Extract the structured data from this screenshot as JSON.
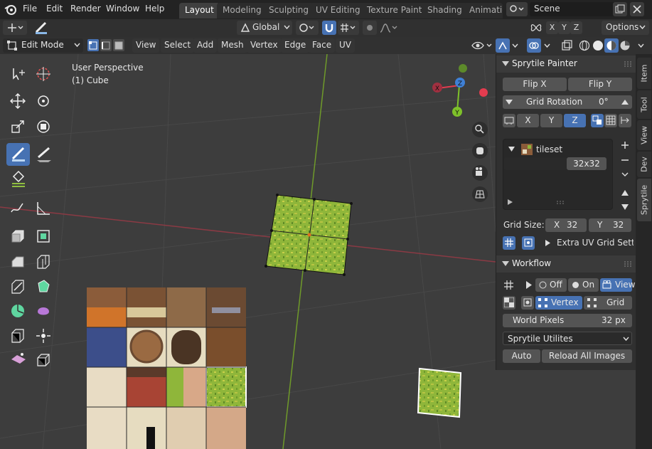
{
  "menu": {
    "logo_icon": "blender-logo-icon",
    "items": [
      "File",
      "Edit",
      "Render",
      "Window",
      "Help"
    ]
  },
  "workspaces": {
    "tabs": [
      "Layout",
      "Modeling",
      "Sculpting",
      "UV Editing",
      "Texture Paint",
      "Shading",
      "Animatic"
    ],
    "active": "Layout"
  },
  "scene": {
    "name": "Scene"
  },
  "toolheader": {
    "orientation": "Global",
    "axes": [
      "X",
      "Y",
      "Z"
    ],
    "options_label": "Options"
  },
  "viewport_header": {
    "mode": "Edit Mode",
    "menus": [
      "View",
      "Select",
      "Add",
      "Mesh",
      "Vertex",
      "Edge",
      "Face",
      "UV"
    ]
  },
  "viewport": {
    "perspective": "User Perspective",
    "object": "(1) Cube",
    "gizmo_axes": [
      "X",
      "Y",
      "Z"
    ],
    "colors": {
      "background": "#3d3d3d",
      "grid_line": "#4a4a4a",
      "x_axis": "#8b3a44",
      "y_axis": "#6f9a2a",
      "x_gizmo": "#e33c4f",
      "y_gizmo": "#7ec12a",
      "z_gizmo": "#3f80d6"
    }
  },
  "npanel": {
    "painter": {
      "title": "Sprytile Painter",
      "flip_x": "Flip X",
      "flip_y": "Flip Y",
      "grid_rotation_label": "Grid Rotation",
      "grid_rotation_value": "0°",
      "axes": [
        "X",
        "Y",
        "Z"
      ],
      "active_axis": "Z",
      "tileset_name": "tileset",
      "tileset_size": "32x32",
      "grid_size_label": "Grid Size:",
      "grid_x_label": "X",
      "grid_x_value": "32",
      "grid_y_label": "Y",
      "grid_y_value": "32",
      "extra_uv": "Extra UV Grid Setti..."
    },
    "workflow": {
      "title": "Workflow",
      "off_label": "Off",
      "on_label": "On",
      "view_label": "View",
      "vertex_label": "Vertex",
      "grid_label": "Grid",
      "world_pixels_label": "World Pixels",
      "world_pixels_value": "32 px",
      "utilities_select": "Sprytile Utilites",
      "auto_label": "Auto",
      "reload_label": "Reload All Images"
    }
  },
  "side_tabs": [
    "Item",
    "Tool",
    "View",
    "Dev",
    "Sprytile"
  ],
  "active_side_tab": "Sprytile"
}
